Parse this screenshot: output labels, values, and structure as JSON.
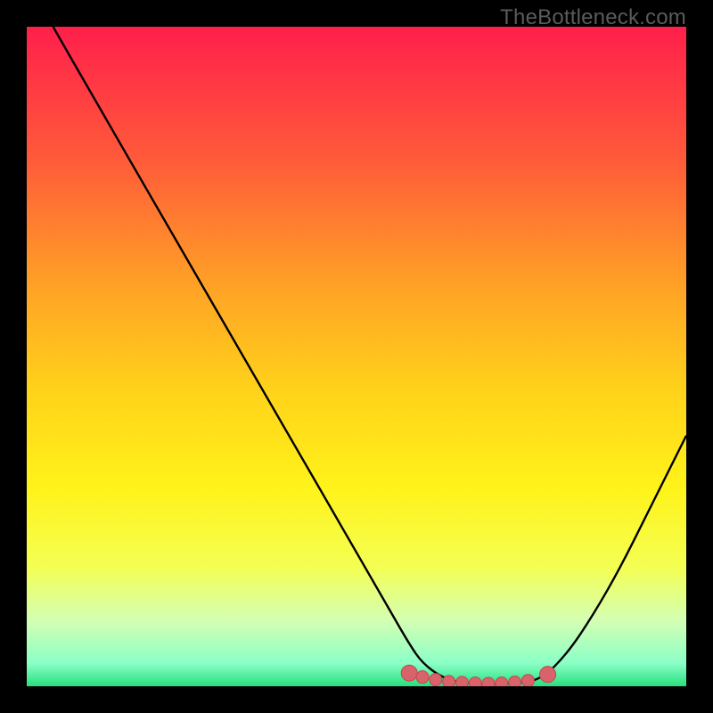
{
  "watermark": "TheBottleneck.com",
  "colors": {
    "black": "#000000",
    "curve": "#000000",
    "marker_fill": "#d9636a",
    "marker_stroke": "#c2484f"
  },
  "chart_data": {
    "type": "line",
    "title": "",
    "xlabel": "",
    "ylabel": "",
    "xlim": [
      0,
      100
    ],
    "ylim": [
      0,
      100
    ],
    "gradient_stops": [
      {
        "offset": 0.0,
        "color": "#ff1f4b"
      },
      {
        "offset": 0.2,
        "color": "#ff5a3a"
      },
      {
        "offset": 0.4,
        "color": "#ffa425"
      },
      {
        "offset": 0.55,
        "color": "#ffd21a"
      },
      {
        "offset": 0.7,
        "color": "#fff31a"
      },
      {
        "offset": 0.82,
        "color": "#f4ff54"
      },
      {
        "offset": 0.9,
        "color": "#d4ffb3"
      },
      {
        "offset": 0.965,
        "color": "#8bffc7"
      },
      {
        "offset": 1.0,
        "color": "#27e07e"
      }
    ],
    "series": [
      {
        "name": "bottleneck-curve",
        "x": [
          4,
          10,
          20,
          30,
          40,
          50,
          55,
          58,
          60,
          63,
          66,
          70,
          74,
          78,
          82,
          86,
          90,
          94,
          98,
          100
        ],
        "y": [
          100,
          89.5,
          72.2,
          54.9,
          37.6,
          20.3,
          11.6,
          6.4,
          3.5,
          1.3,
          0.5,
          0.3,
          0.4,
          1.0,
          5.0,
          11.0,
          18.0,
          26.0,
          34.0,
          38.0
        ]
      }
    ],
    "markers": {
      "name": "optimal-range",
      "points": [
        {
          "x": 58,
          "y": 2.0
        },
        {
          "x": 60,
          "y": 1.4
        },
        {
          "x": 62,
          "y": 1.0
        },
        {
          "x": 64,
          "y": 0.7
        },
        {
          "x": 66,
          "y": 0.55
        },
        {
          "x": 68,
          "y": 0.45
        },
        {
          "x": 70,
          "y": 0.4
        },
        {
          "x": 72,
          "y": 0.45
        },
        {
          "x": 74,
          "y": 0.6
        },
        {
          "x": 76,
          "y": 0.85
        },
        {
          "x": 79,
          "y": 1.8
        }
      ],
      "radius_first_last": 9,
      "radius_mid": 7
    }
  }
}
